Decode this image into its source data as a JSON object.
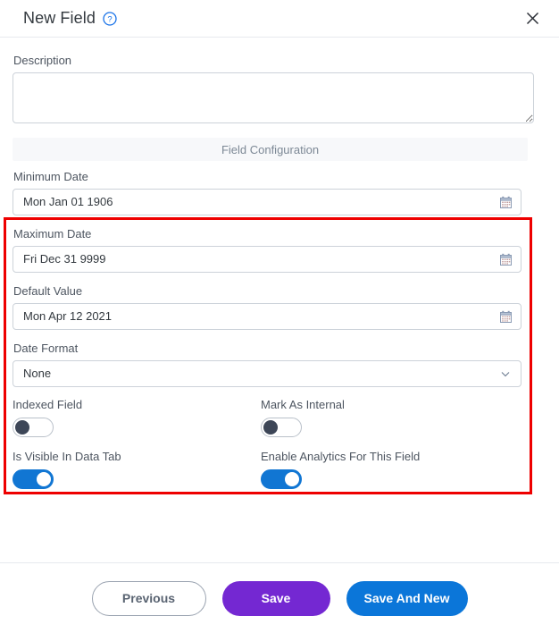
{
  "header": {
    "title": "New Field",
    "help_icon": "question-circle-icon",
    "close_icon": "close-icon"
  },
  "description": {
    "label": "Description",
    "value": "",
    "placeholder": ""
  },
  "section": {
    "label": "Field Configuration"
  },
  "config_fields": [
    {
      "label": "Minimum Date",
      "value": "Mon Jan 01 1906",
      "adorn_icon": "calendar-icon",
      "type": "date"
    },
    {
      "label": "Maximum Date",
      "value": "Fri Dec 31 9999",
      "adorn_icon": "calendar-icon",
      "type": "date"
    },
    {
      "label": "Default Value",
      "value": "Mon Apr 12 2021",
      "adorn_icon": "calendar-icon",
      "type": "date"
    },
    {
      "label": "Date Format",
      "value": "None",
      "adorn_icon": "chevron-down-icon",
      "type": "select"
    }
  ],
  "toggles": [
    {
      "label": "Indexed Field",
      "state": "off"
    },
    {
      "label": "Mark As Internal",
      "state": "off"
    },
    {
      "label": "Is Visible In Data Tab",
      "state": "on"
    },
    {
      "label": "Enable Analytics For This Field",
      "state": "on"
    }
  ],
  "footer": {
    "previous_label": "Previous",
    "save_label": "Save",
    "save_and_new_label": "Save And New"
  },
  "colors": {
    "accent_blue": "#0b76d9",
    "save_purple": "#7428d2",
    "toggle_on": "#1176d3",
    "toggle_knob_off": "#3d4657",
    "highlight_red": "#ee0000",
    "label_gray": "#4d5560",
    "section_bg": "#f7f8fa"
  },
  "annotation": {
    "highlight_region": "field-configuration-date-settings"
  }
}
